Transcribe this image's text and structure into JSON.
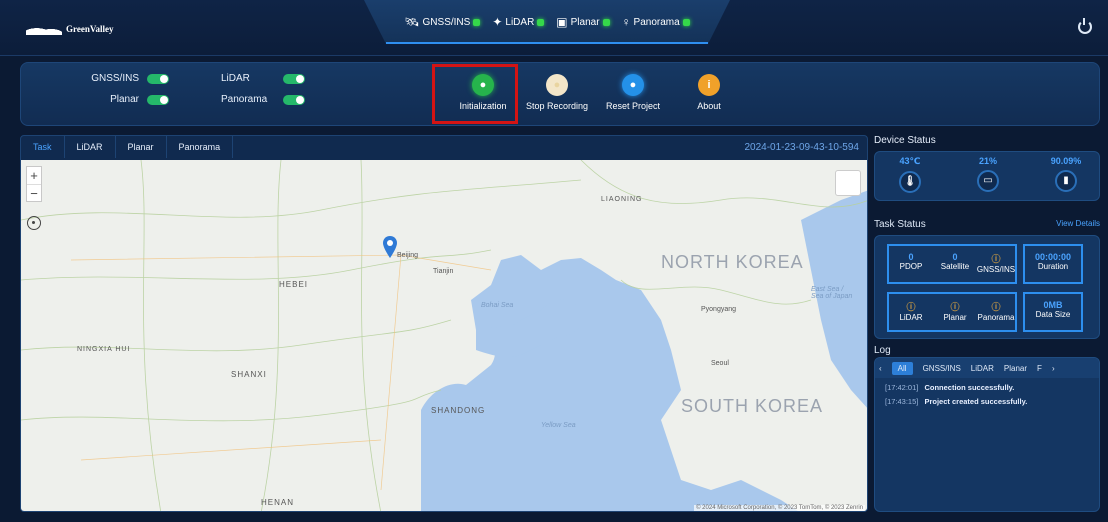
{
  "header": {
    "logo_text": "GreenValley",
    "status": [
      {
        "label": "GNSS/INS",
        "icon": "satellite-icon"
      },
      {
        "label": "LiDAR",
        "icon": "lidar-icon"
      },
      {
        "label": "Planar",
        "icon": "camera-icon"
      },
      {
        "label": "Panorama",
        "icon": "panorama-icon"
      }
    ],
    "status_color": "#35d84a"
  },
  "controls": {
    "toggles": [
      {
        "label": "GNSS/INS",
        "on": true
      },
      {
        "label": "Planar",
        "on": true
      },
      {
        "label": "LiDAR",
        "on": true
      },
      {
        "label": "Panorama",
        "on": true
      }
    ],
    "actions": [
      {
        "label": "Initialization",
        "color": "#26b44c"
      },
      {
        "label": "Stop Recording",
        "color": "#f3e6c9"
      },
      {
        "label": "Reset Project",
        "color": "#2491e8"
      },
      {
        "label": "About",
        "color": "#f0a12a",
        "icon_text": "i"
      }
    ]
  },
  "map_panel": {
    "tabs": [
      "Task",
      "LiDAR",
      "Planar",
      "Panorama"
    ],
    "active_tab": "Task",
    "timestamp": "2024-01-23-09-43-10-594",
    "labels": {
      "north_korea": "NORTH KOREA",
      "south_korea": "SOUTH KOREA",
      "bohai": "Bohai Sea",
      "yellow": "Yellow Sea",
      "hebei": "HEBEI",
      "shanxi": "SHANXI",
      "shandong": "SHANDONG",
      "henan": "HENAN",
      "beijing": "Beijing",
      "tianjin": "Tianjin",
      "liaoning": "LIAONING",
      "pyongyang": "Pyongyang",
      "seoul": "Seoul",
      "sea_of_japan": "East Sea / Sea of Japan",
      "inner_mongolia": "NINGXIA HUI"
    },
    "copyright": "© 2024 Microsoft Corporation, © 2023 TomTom, © 2023 Zenrin"
  },
  "device_status": {
    "title": "Device Status",
    "items": [
      {
        "value": "43℃",
        "icon": "thermometer-icon"
      },
      {
        "value": "21%",
        "icon": "storage-icon"
      },
      {
        "value": "90.09%",
        "icon": "battery-icon"
      }
    ]
  },
  "task_status": {
    "title": "Task Status",
    "view_details": "View Details",
    "cells": [
      {
        "value": "0",
        "label": "PDOP"
      },
      {
        "value": "0",
        "label": "Satellite"
      },
      {
        "value": "ⓘ",
        "label": "GNSS/INS"
      },
      {
        "value": "00:00:00",
        "label": "Duration"
      },
      {
        "value": "ⓘ",
        "label": "LiDAR"
      },
      {
        "value": "ⓘ",
        "label": "Planar"
      },
      {
        "value": "ⓘ",
        "label": "Panorama"
      },
      {
        "value": "0MB",
        "label": "Data Size"
      }
    ]
  },
  "log": {
    "title": "Log",
    "tabs": [
      "All",
      "GNSS/INS",
      "LiDAR",
      "Planar",
      "F"
    ],
    "lines": [
      {
        "time": "[17:42:01]",
        "msg": "Connection successfully."
      },
      {
        "time": "[17:43:15]",
        "msg": "Project created successfully."
      }
    ]
  }
}
